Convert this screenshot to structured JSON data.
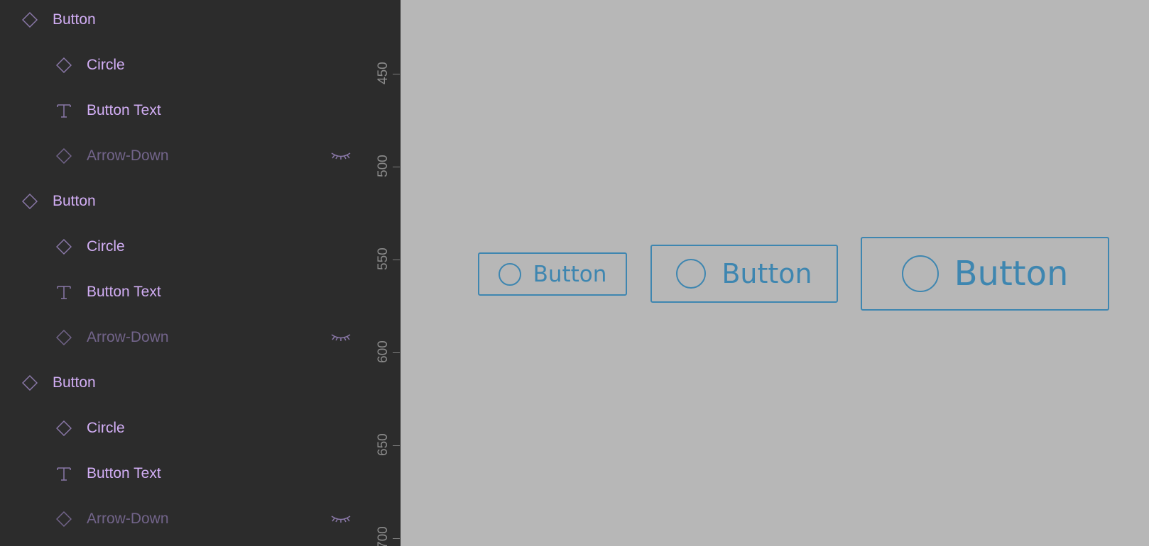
{
  "colors": {
    "panel_bg": "#2c2c2c",
    "canvas_bg": "#b7b7b7",
    "layer_label": "#d2aef5",
    "hidden_layer_label": "#72648a",
    "icon_color": "#8a78a8",
    "component_stroke": "#3e86b0"
  },
  "layers": [
    {
      "label": "Button",
      "type": "component",
      "icon": "diamond-icon",
      "hidden": false
    },
    {
      "label": "Circle",
      "type": "component",
      "icon": "diamond-icon",
      "hidden": false
    },
    {
      "label": "Button Text",
      "type": "text",
      "icon": "text-icon",
      "hidden": false
    },
    {
      "label": "Arrow-Down",
      "type": "component",
      "icon": "diamond-icon",
      "hidden": true
    },
    {
      "label": "Button",
      "type": "component",
      "icon": "diamond-icon",
      "hidden": false
    },
    {
      "label": "Circle",
      "type": "component",
      "icon": "diamond-icon",
      "hidden": false
    },
    {
      "label": "Button Text",
      "type": "text",
      "icon": "text-icon",
      "hidden": false
    },
    {
      "label": "Arrow-Down",
      "type": "component",
      "icon": "diamond-icon",
      "hidden": true
    },
    {
      "label": "Button",
      "type": "component",
      "icon": "diamond-icon",
      "hidden": false
    },
    {
      "label": "Circle",
      "type": "component",
      "icon": "diamond-icon",
      "hidden": false
    },
    {
      "label": "Button Text",
      "type": "text",
      "icon": "text-icon",
      "hidden": false
    },
    {
      "label": "Arrow-Down",
      "type": "component",
      "icon": "diamond-icon",
      "hidden": true
    }
  ],
  "ruler": {
    "labels": [
      "450",
      "500",
      "550",
      "600",
      "650",
      "700"
    ]
  },
  "canvas": {
    "buttons": [
      {
        "text": "Button",
        "size": "small"
      },
      {
        "text": "Button",
        "size": "medium"
      },
      {
        "text": "Button",
        "size": "large"
      }
    ]
  }
}
